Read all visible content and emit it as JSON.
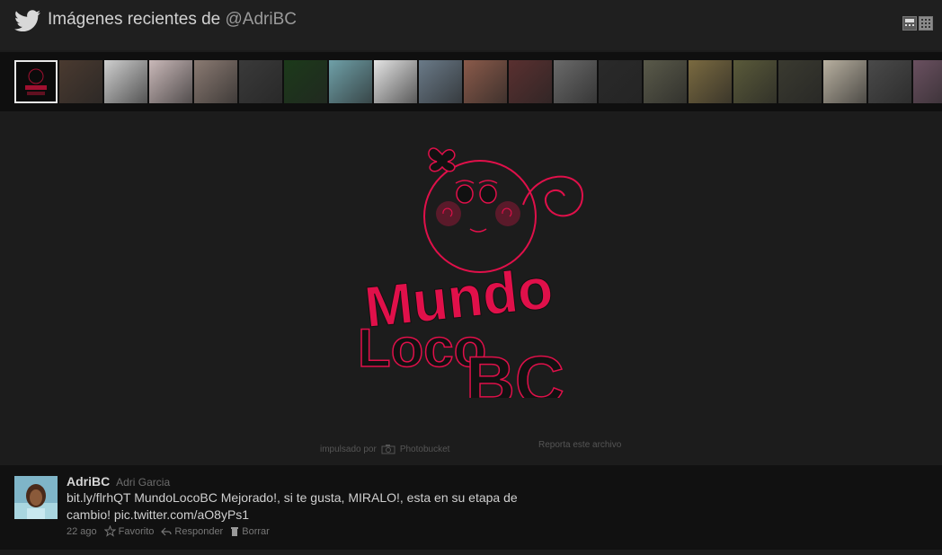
{
  "header": {
    "title_prefix": "Imágenes recientes de ",
    "title_handle": "@AdriBC",
    "view_options": [
      "list-view",
      "grid-view"
    ]
  },
  "thumbnails": {
    "count": 21,
    "active_index": 0,
    "colors": [
      "#0b0b0b",
      "#4a3a30",
      "#cfcfcf",
      "#c9b8b8",
      "#8a7a72",
      "#3a3a3a",
      "#1c3a1a",
      "#6fa0a8",
      "#e4e4e4",
      "#6a7a88",
      "#8a5a4a",
      "#5a3030",
      "#6a6a6a",
      "#2a2a2a",
      "#5a5a4a",
      "#7a6a40",
      "#5a5a3a",
      "#3a3a30",
      "#b8b0a0",
      "#4a4a4a",
      "#6a5060"
    ]
  },
  "main": {
    "logo_text_pink": "Mundo",
    "logo_text_black": "Loco",
    "logo_text_bc": "BC",
    "powered_by_label": "impulsado por",
    "powered_by_brand": "Photobucket",
    "report_label": "Reporta este archivo",
    "accent_color": "#e0104a"
  },
  "tweet": {
    "username": "AdriBC",
    "display_name": "Adri Garcia",
    "text": "bit.ly/flrhQT MundoLocoBC Mejorado!, si te gusta, MIRALO!, esta en su etapa de cambio! pic.twitter.com/aO8yPs1",
    "time": "22 ago",
    "favorite_label": "Favorito",
    "reply_label": "Responder",
    "delete_label": "Borrar"
  }
}
